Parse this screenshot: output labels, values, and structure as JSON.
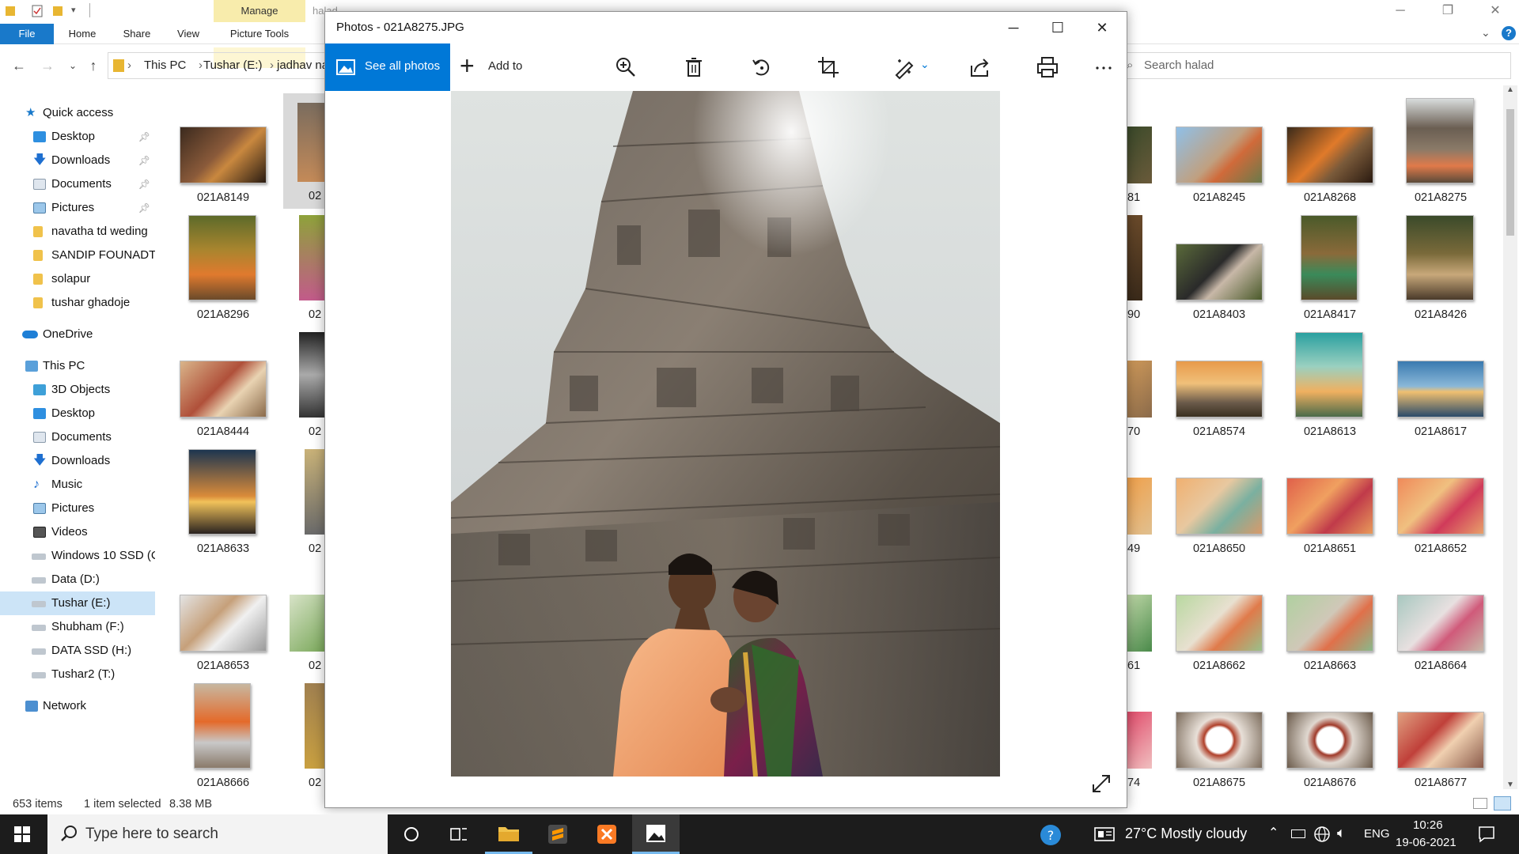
{
  "explorer": {
    "ribbon": {
      "manage_label": "Manage",
      "picture_tools_label": "Picture Tools",
      "tabs": [
        "File",
        "Home",
        "Share",
        "View"
      ],
      "title_fragment": "halad"
    },
    "address": {
      "crumbs": [
        "This PC",
        "Tushar (E:)",
        "jadhav na"
      ]
    },
    "search": {
      "placeholder": "Search halad"
    },
    "nav": {
      "quick_access": "Quick access",
      "quick_items": [
        "Desktop",
        "Downloads",
        "Documents",
        "Pictures",
        "navatha td weding",
        "SANDIP FOUNADTI",
        "solapur",
        "tushar ghadoje"
      ],
      "onedrive": "OneDrive",
      "this_pc": "This PC",
      "pc_items": [
        "3D Objects",
        "Desktop",
        "Documents",
        "Downloads",
        "Music",
        "Pictures",
        "Videos",
        "Windows 10 SSD (C",
        "Data (D:)",
        "Tushar (E:)",
        "Shubham (F:)",
        "DATA SSD (H:)",
        "Tushar2 (T:)"
      ],
      "network": "Network"
    },
    "left_thumbs": [
      "021A8149",
      "021A8296",
      "021A8444",
      "021A8633",
      "021A8653",
      "021A8666"
    ],
    "second_col_cut": [
      "02",
      "02",
      "02",
      "02",
      "02",
      "02"
    ],
    "right_cut": [
      "81",
      "90",
      "70",
      "49",
      "61",
      "74"
    ],
    "right_thumbs": [
      [
        "021A8245",
        "021A8268",
        "021A8275"
      ],
      [
        "021A8403",
        "021A8417",
        "021A8426"
      ],
      [
        "021A8574",
        "021A8613",
        "021A8617"
      ],
      [
        "021A8650",
        "021A8651",
        "021A8652"
      ],
      [
        "021A8662",
        "021A8663",
        "021A8664"
      ],
      [
        "021A8675",
        "021A8676",
        "021A8677"
      ]
    ],
    "status": {
      "items": "653 items",
      "selected": "1 item selected",
      "size": "8.38 MB"
    }
  },
  "photos": {
    "title": "Photos - 021A8275.JPG",
    "see_all": "See all photos",
    "add_to": "Add to",
    "toolbar_icons": [
      "zoom-icon",
      "delete-icon",
      "rotate-icon",
      "crop-icon",
      "edit-icon",
      "share-icon",
      "print-icon",
      "more-icon"
    ]
  },
  "taskbar": {
    "search_placeholder": "Type here to search",
    "weather": "27°C  Mostly cloudy",
    "lang": "ENG",
    "time": "10:26",
    "date": "19-06-2021"
  },
  "colors": {
    "accent": "#0078d7",
    "file_tab": "#1979ca",
    "manage": "#f8ecac"
  }
}
